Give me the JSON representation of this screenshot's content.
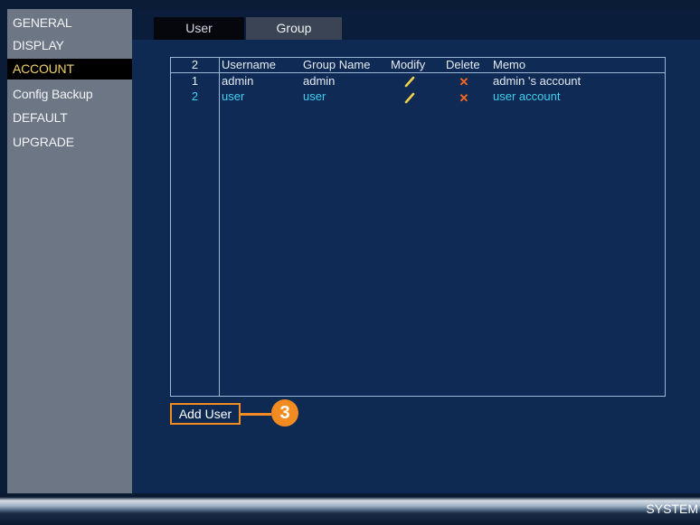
{
  "sidebar": {
    "items": [
      {
        "label": "GENERAL",
        "active": false
      },
      {
        "label": "DISPLAY",
        "active": false
      },
      {
        "label": "ACCOUNT",
        "active": true
      },
      {
        "label": "Config Backup",
        "active": false
      },
      {
        "label": "DEFAULT",
        "active": false
      },
      {
        "label": "UPGRADE",
        "active": false
      }
    ]
  },
  "tabs": {
    "user": "User",
    "group": "Group"
  },
  "table": {
    "count": "2",
    "headers": {
      "username": "Username",
      "group_name": "Group Name",
      "modify": "Modify",
      "delete": "Delete",
      "memo": "Memo"
    },
    "rows": [
      {
        "num": "1",
        "username": "admin",
        "group": "admin",
        "memo": "admin 's account"
      },
      {
        "num": "2",
        "username": "user",
        "group": "user",
        "memo": "user account"
      }
    ]
  },
  "add_user_label": "Add User",
  "callout_number": "3",
  "footer": {
    "system_label": "SYSTEM"
  },
  "icons": {
    "modify": "pencil-icon",
    "delete": "close-icon"
  },
  "colors": {
    "accent": "#f28b22",
    "active_text": "#f0d36a",
    "row_highlight": "#3fd0f0",
    "delete": "#ff6a1a"
  }
}
